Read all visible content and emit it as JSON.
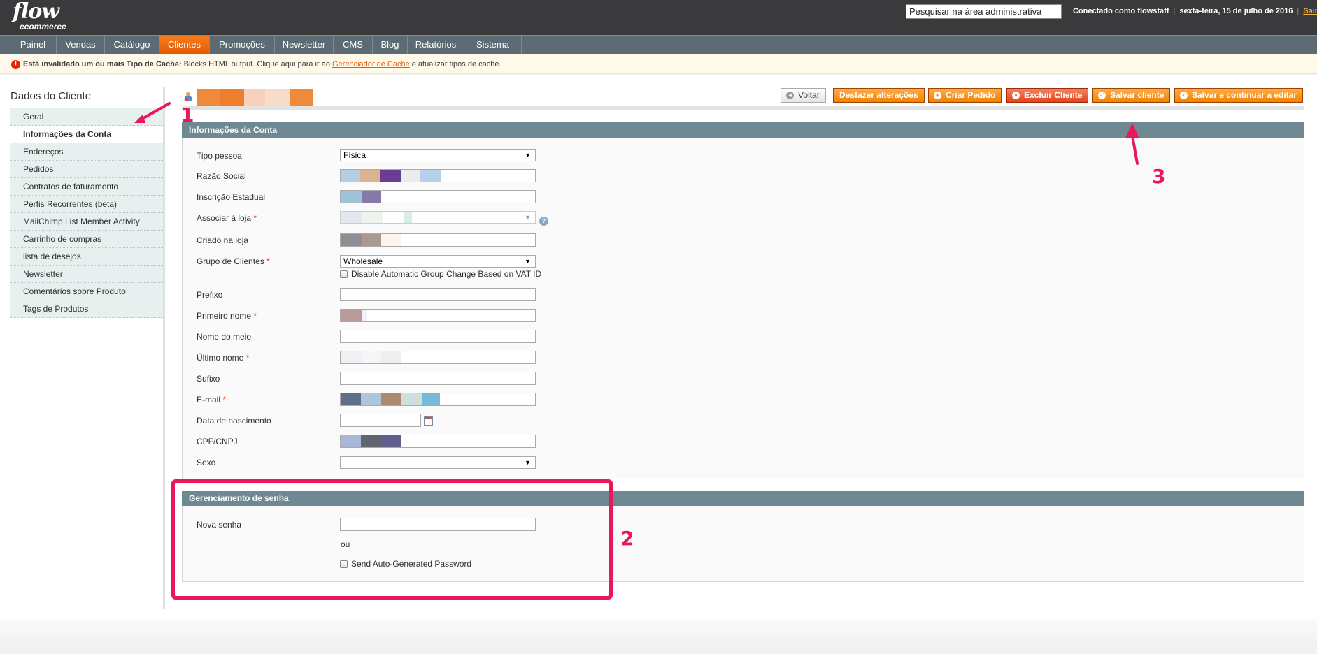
{
  "header": {
    "logo_main": "flow",
    "logo_sub": "ecommerce",
    "search_value": "Pesquisar na área administrativa",
    "logged_in": "Conectado como flowstaff",
    "date": "sexta-feira, 15 de julho de 2016",
    "logout": "Sair"
  },
  "nav": {
    "items": [
      {
        "label": "Painel"
      },
      {
        "label": "Vendas"
      },
      {
        "label": "Catálogo"
      },
      {
        "label": "Clientes"
      },
      {
        "label": "Promoções"
      },
      {
        "label": "Newsletter"
      },
      {
        "label": "CMS"
      },
      {
        "label": "Blog"
      },
      {
        "label": "Relatórios"
      },
      {
        "label": "Sistema"
      }
    ],
    "active": "Clientes"
  },
  "notice": {
    "bold": "Está invalidado um ou mais Tipo de Cache:",
    "text1": " Blocks HTML output. Clique aqui para ir ao ",
    "link": "Gerenciador de Cache",
    "text2": " e atualizar tipos de cache."
  },
  "sidebar": {
    "title": "Dados do Cliente",
    "items": [
      {
        "label": "Geral"
      },
      {
        "label": "Informações da Conta"
      },
      {
        "label": "Endereços"
      },
      {
        "label": "Pedidos"
      },
      {
        "label": "Contratos de faturamento"
      },
      {
        "label": "Perfis Recorrentes (beta)"
      },
      {
        "label": "MailChimp List Member Activity"
      },
      {
        "label": "Carrinho de compras"
      },
      {
        "label": "lista de desejos"
      },
      {
        "label": "Newsletter"
      },
      {
        "label": "Comentários sobre Produto"
      },
      {
        "label": "Tags de Produtos"
      }
    ]
  },
  "toolbar": {
    "back": "Voltar",
    "reset": "Desfazer alterações",
    "create_order": "Criar Pedido",
    "delete": "Excluir Cliente",
    "save": "Salvar cliente",
    "save_continue": "Salvar e continuar a editar"
  },
  "account": {
    "title": "Informações da Conta",
    "tipo_pessoa_label": "Tipo pessoa",
    "tipo_pessoa_value": "Física",
    "razao_social_label": "Razão Social",
    "inscricao_label": "Inscrição Estadual",
    "associar_label": "Associar à loja",
    "criado_label": "Criado na loja",
    "grupo_label": "Grupo de Clientes",
    "grupo_value": "Wholesale",
    "vat_checkbox": "Disable Automatic Group Change Based on VAT ID",
    "prefixo_label": "Prefixo",
    "primeiro_label": "Primeiro nome",
    "meio_label": "Nome do meio",
    "ultimo_label": "Último nome",
    "sufixo_label": "Sufixo",
    "email_label": "E-mail",
    "nascimento_label": "Data de nascimento",
    "cpf_label": "CPF/CNPJ",
    "sexo_label": "Sexo",
    "required_mark": "*"
  },
  "password": {
    "title": "Gerenciamento de senha",
    "nova_label": "Nova senha",
    "ou": "ou",
    "auto_checkbox": "Send Auto-Generated Password"
  },
  "annotations": {
    "n1": "1",
    "n2": "2",
    "n3": "3",
    "color": "#e8185b"
  },
  "colors": {
    "accent": "#eb5e00",
    "nav": "#5c6b73",
    "fieldset_header": "#6f8992"
  }
}
